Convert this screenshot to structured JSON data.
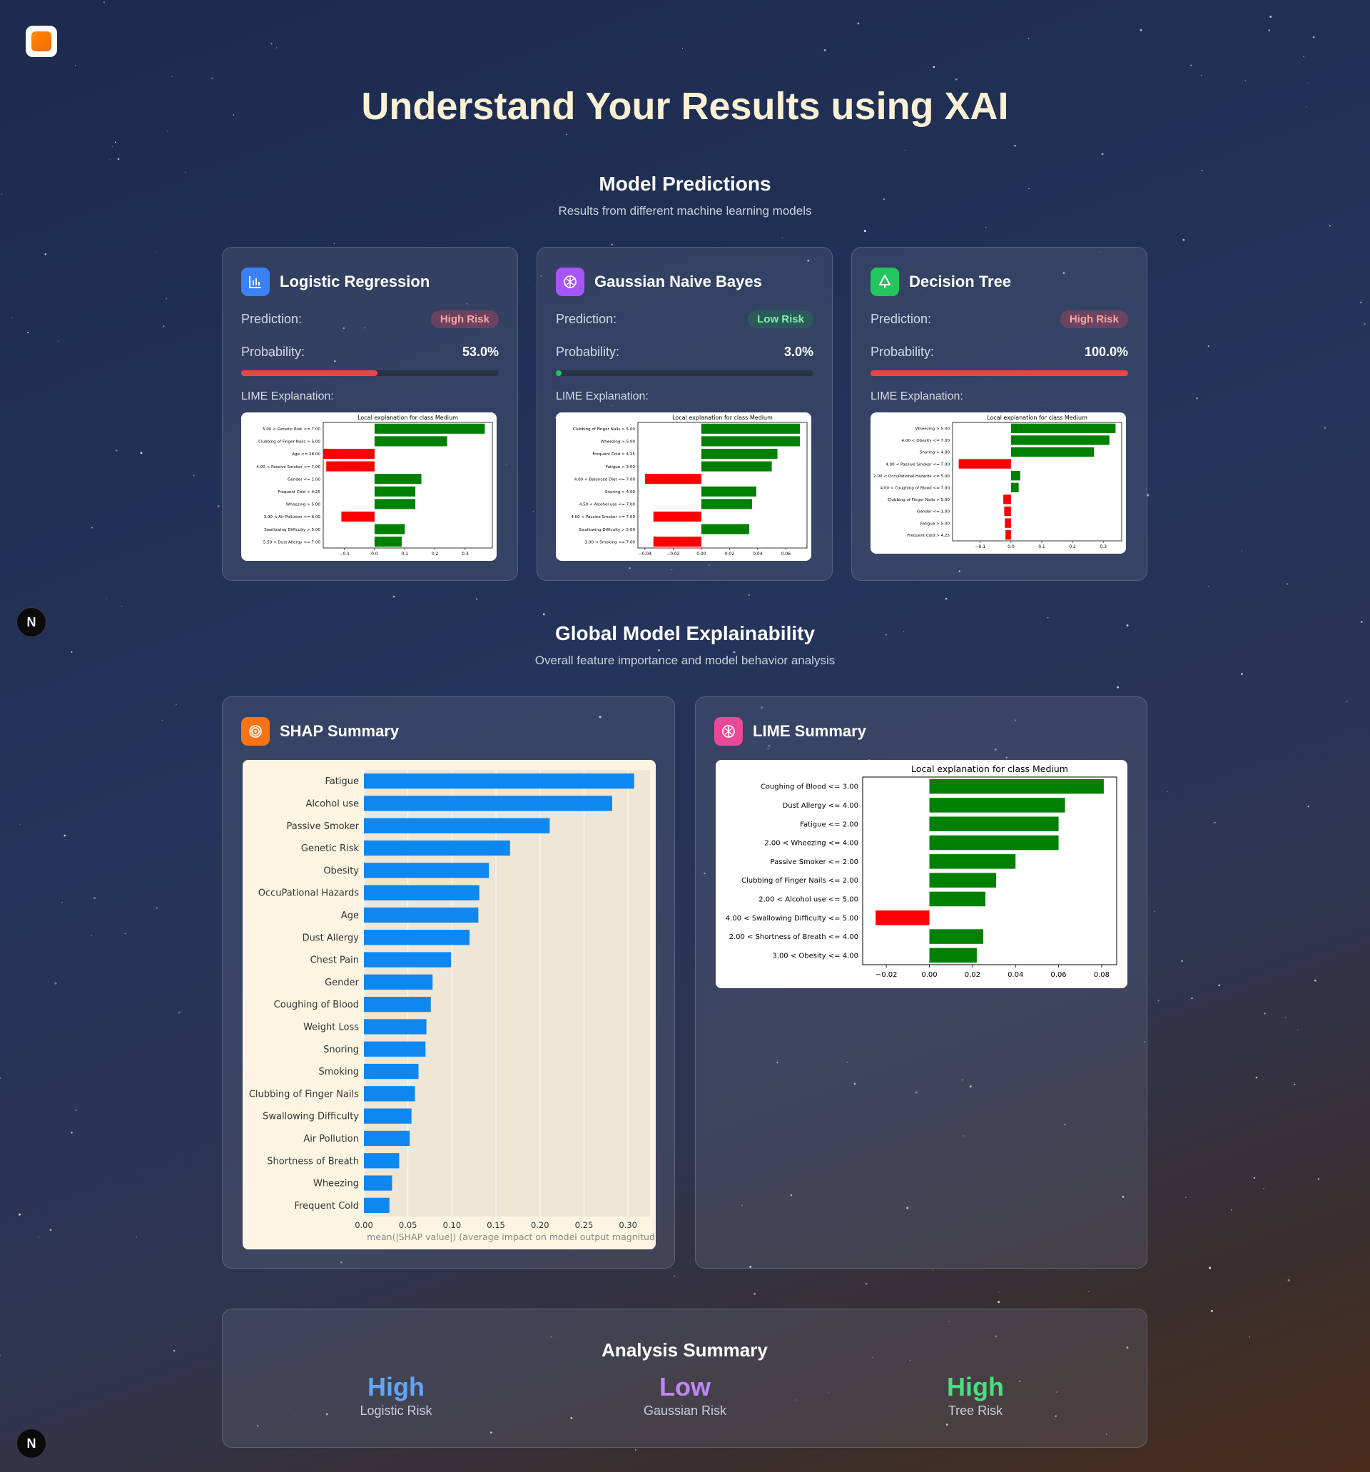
{
  "page": {
    "title": "Understand Your Results using XAI",
    "nav_badge": "N"
  },
  "predictions": {
    "title": "Model Predictions",
    "subtitle": "Results from different machine learning models",
    "prediction_label": "Prediction:",
    "probability_label": "Probability:",
    "lime_label": "LIME Explanation:",
    "models": [
      {
        "name": "Logistic Regression",
        "icon": "bar-chart-icon",
        "icon_color": "#3b82f6",
        "prediction": "High Risk",
        "risk": "high",
        "probability_text": "53.0%",
        "probability": 0.53,
        "bar_color": "#ef4444",
        "lime": {
          "title": "Local explanation for class Medium",
          "xlim": [
            -0.17,
            0.39
          ],
          "ticks": [
            -0.1,
            0.0,
            0.1,
            0.2,
            0.3
          ],
          "tick_labels": [
            "−0.1",
            "0.0",
            "0.1",
            "0.2",
            "0.3"
          ],
          "features": [
            {
              "label": "5.00 < Genetic Risk <= 7.00",
              "value": 0.365
            },
            {
              "label": "Clubbing of Finger Nails > 5.00",
              "value": 0.24
            },
            {
              "label": "Age <= 28.00",
              "value": -0.17
            },
            {
              "label": "4.00 < Passive Smoker <= 7.00",
              "value": -0.16
            },
            {
              "label": "Gender <= 1.00",
              "value": 0.155
            },
            {
              "label": "Frequent Cold > 4.25",
              "value": 0.135
            },
            {
              "label": "Wheezing > 5.00",
              "value": 0.135
            },
            {
              "label": "3.00 < Air Pollution <= 6.00",
              "value": -0.11
            },
            {
              "label": "Swallowing Difficulty > 5.00",
              "value": 0.1
            },
            {
              "label": "5.50 < Dust Allergy <= 7.00",
              "value": 0.09
            }
          ]
        }
      },
      {
        "name": "Gaussian Naive Bayes",
        "icon": "brain-icon",
        "icon_color": "#a855f7",
        "prediction": "Low Risk",
        "risk": "low",
        "probability_text": "3.0%",
        "probability": 0.03,
        "bar_color": "#22c55e",
        "lime": {
          "title": "Local explanation for class Medium",
          "xlim": [
            -0.045,
            0.075
          ],
          "ticks": [
            -0.04,
            -0.02,
            0.0,
            0.02,
            0.04,
            0.06
          ],
          "tick_labels": [
            "−0.04",
            "−0.02",
            "0.00",
            "0.02",
            "0.04",
            "0.06"
          ],
          "features": [
            {
              "label": "Clubbing of Finger Nails > 5.00",
              "value": 0.07
            },
            {
              "label": "Wheezing > 5.00",
              "value": 0.07
            },
            {
              "label": "Frequent Cold > 4.25",
              "value": 0.054
            },
            {
              "label": "Fatigue > 3.00",
              "value": 0.05
            },
            {
              "label": "4.00 < Balanced Diet <= 7.00",
              "value": -0.04
            },
            {
              "label": "Snoring > 4.00",
              "value": 0.039
            },
            {
              "label": "4.50 < Alcohol use <= 7.00",
              "value": 0.036
            },
            {
              "label": "4.00 < Passive Smoker <= 7.00",
              "value": -0.034
            },
            {
              "label": "Swallowing Difficulty > 5.00",
              "value": 0.034
            },
            {
              "label": "3.00 < Smoking <= 7.00",
              "value": -0.034
            }
          ]
        }
      },
      {
        "name": "Decision Tree",
        "icon": "tree-icon",
        "icon_color": "#22c55e",
        "prediction": "High Risk",
        "risk": "high",
        "probability_text": "100.0%",
        "probability": 1.0,
        "bar_color": "#ef4444",
        "lime": {
          "title": "Local explanation for class Medium",
          "xlim": [
            -0.19,
            0.36
          ],
          "ticks": [
            -0.1,
            0.0,
            0.1,
            0.2,
            0.3
          ],
          "tick_labels": [
            "−0.1",
            "0.0",
            "0.1",
            "0.2",
            "0.3"
          ],
          "features": [
            {
              "label": "Wheezing > 5.00",
              "value": 0.34
            },
            {
              "label": "4.00 < Obesity <= 7.00",
              "value": 0.32
            },
            {
              "label": "Snoring > 4.00",
              "value": 0.27
            },
            {
              "label": "4.00 < Passive Smoker <= 7.00",
              "value": -0.17
            },
            {
              "label": "2.00 < OccuPational Hazards <= 5.00",
              "value": 0.03
            },
            {
              "label": "4.00 < Coughing of Blood <= 7.00",
              "value": 0.025
            },
            {
              "label": "Clubbing of Finger Nails > 5.00",
              "value": -0.025
            },
            {
              "label": "Gender <= 1.00",
              "value": -0.022
            },
            {
              "label": "Fatigue > 5.00",
              "value": -0.02
            },
            {
              "label": "Frequent Cold > 4.25",
              "value": -0.018
            }
          ]
        }
      }
    ]
  },
  "global": {
    "title": "Global Model Explainability",
    "subtitle": "Overall feature importance and model behavior analysis",
    "shap_card_title": "SHAP Summary",
    "shap_icon": "target-icon",
    "shap_icon_color": "#f97316",
    "lime_card_title": "LIME Summary",
    "lime_icon": "brain-icon",
    "lime_icon_color": "#ec4899"
  },
  "chart_data": [
    {
      "type": "bar",
      "orientation": "horizontal",
      "categories": [
        "Fatigue",
        "Alcohol use",
        "Passive Smoker",
        "Genetic Risk",
        "Obesity",
        "OccuPational Hazards",
        "Age",
        "Dust Allergy",
        "Chest Pain",
        "Gender",
        "Coughing of Blood",
        "Weight Loss",
        "Snoring",
        "Smoking",
        "Clubbing of Finger Nails",
        "Swallowing Difficulty",
        "Air Pollution",
        "Shortness of Breath",
        "Wheezing",
        "Frequent Cold"
      ],
      "values": [
        0.307,
        0.282,
        0.211,
        0.166,
        0.142,
        0.131,
        0.13,
        0.12,
        0.099,
        0.078,
        0.076,
        0.071,
        0.07,
        0.062,
        0.058,
        0.054,
        0.052,
        0.04,
        0.032,
        0.029
      ],
      "xlabel": "mean(|SHAP value|) (average impact on model output magnitud",
      "xlim": [
        0,
        0.325
      ],
      "xticks": [
        0.0,
        0.05,
        0.1,
        0.15,
        0.2,
        0.25,
        0.3
      ],
      "xtick_labels": [
        "0.00",
        "0.05",
        "0.10",
        "0.15",
        "0.20",
        "0.25",
        "0.30"
      ],
      "grid": true,
      "bar_color": "#0f87f0"
    },
    {
      "type": "bar",
      "orientation": "horizontal",
      "title": "Local explanation for class Medium",
      "categories": [
        "Coughing of Blood <= 3.00",
        "Dust Allergy <= 4.00",
        "Fatigue <= 2.00",
        "2.00 < Wheezing <= 4.00",
        "Passive Smoker <= 2.00",
        "Clubbing of Finger Nails <= 2.00",
        "2.00 < Alcohol use <= 5.00",
        "4.00 < Swallowing Difficulty <= 5.00",
        "2.00 < Shortness of Breath <= 4.00",
        "3.00 < Obesity <= 4.00"
      ],
      "values": [
        0.081,
        0.063,
        0.06,
        0.06,
        0.04,
        0.031,
        0.026,
        -0.025,
        0.025,
        0.022
      ],
      "xlim": [
        -0.031,
        0.087
      ],
      "xticks": [
        -0.02,
        0.0,
        0.02,
        0.04,
        0.06,
        0.08
      ],
      "xtick_labels": [
        "−0.02",
        "0.00",
        "0.02",
        "0.04",
        "0.06",
        "0.08"
      ],
      "positive_color": "#008000",
      "negative_color": "#ff0000"
    }
  ],
  "analysis_summary": {
    "title": "Analysis Summary",
    "items": [
      {
        "value": "High",
        "label": "Logistic Risk",
        "color": "#60a5fa"
      },
      {
        "value": "Low",
        "label": "Gaussian Risk",
        "color": "#c084fc"
      },
      {
        "value": "High",
        "label": "Tree Risk",
        "color": "#4ade80"
      }
    ]
  }
}
